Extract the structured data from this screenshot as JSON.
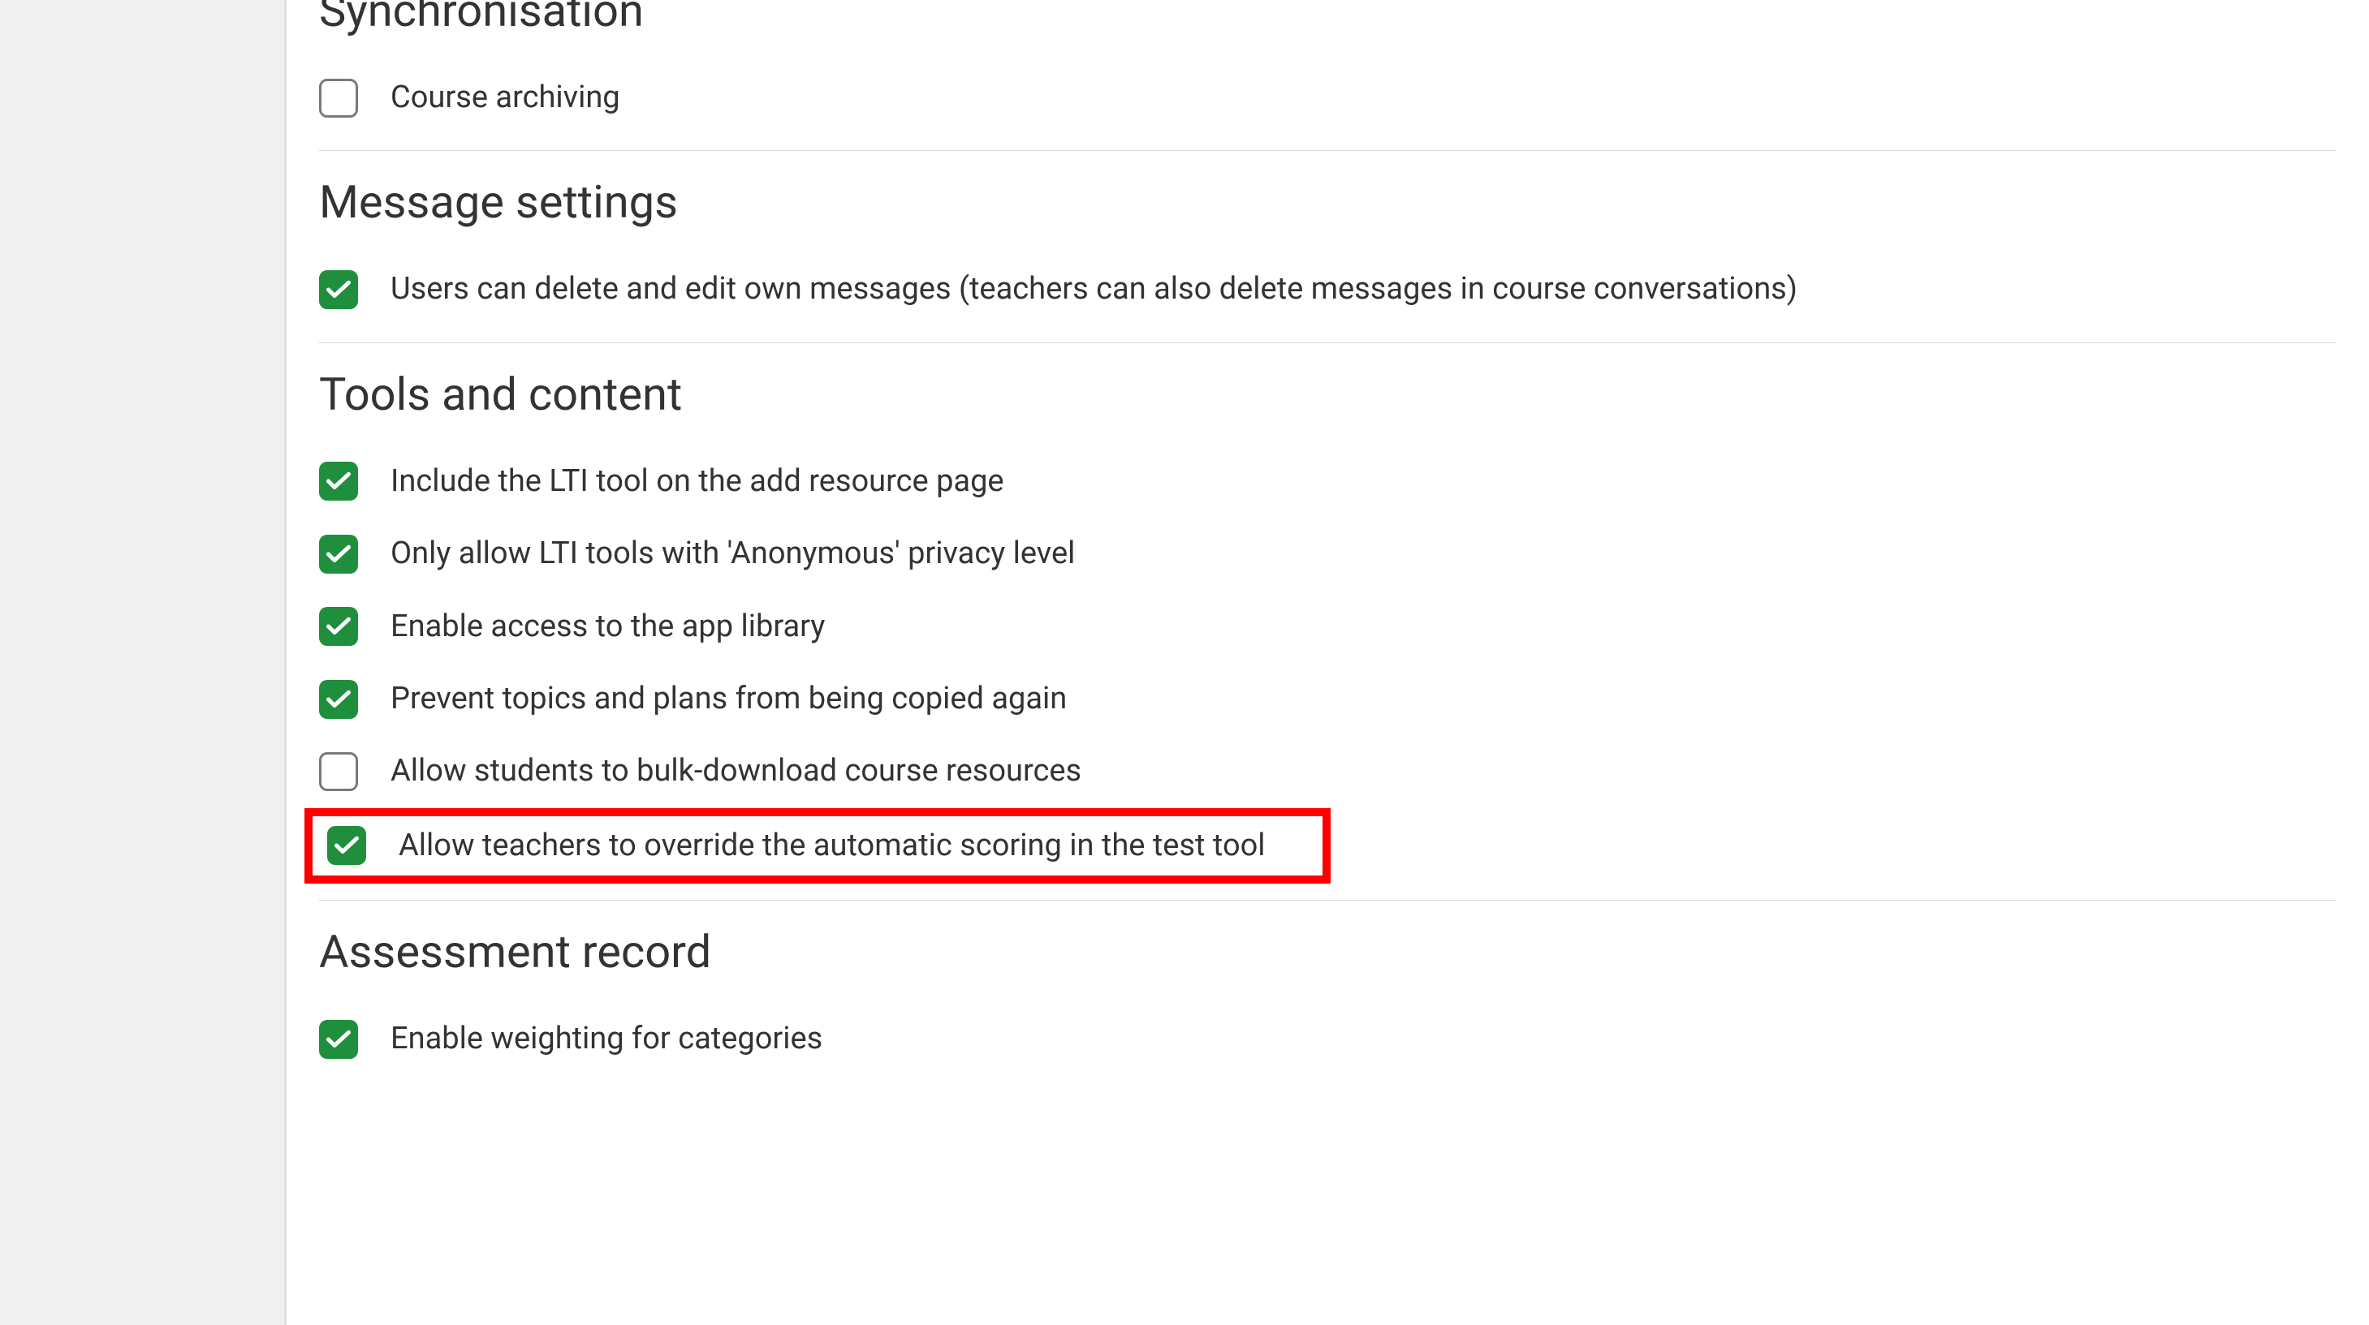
{
  "sections": {
    "synchronisation": {
      "heading": "Synchronisation",
      "items": [
        {
          "label": "Course archiving",
          "checked": false
        }
      ]
    },
    "message_settings": {
      "heading": "Message settings",
      "items": [
        {
          "label": "Users can delete and edit own messages (teachers can also delete messages in course conversations)",
          "checked": true
        }
      ]
    },
    "tools_and_content": {
      "heading": "Tools and content",
      "items": [
        {
          "label": "Include the LTI tool on the add resource page",
          "checked": true
        },
        {
          "label": "Only allow LTI tools with 'Anonymous' privacy level",
          "checked": true
        },
        {
          "label": "Enable access to the app library",
          "checked": true
        },
        {
          "label": "Prevent topics and plans from being copied again",
          "checked": true
        },
        {
          "label": "Allow students to bulk-download course resources",
          "checked": false
        },
        {
          "label": "Allow teachers to override the automatic scoring in the test tool",
          "checked": true,
          "highlighted": true
        }
      ]
    },
    "assessment_record": {
      "heading": "Assessment record",
      "items": [
        {
          "label": "Enable weighting for categories",
          "checked": true
        }
      ]
    }
  },
  "colors": {
    "checkbox_checked": "#1f8f3e",
    "highlight_border": "#ff0000"
  }
}
